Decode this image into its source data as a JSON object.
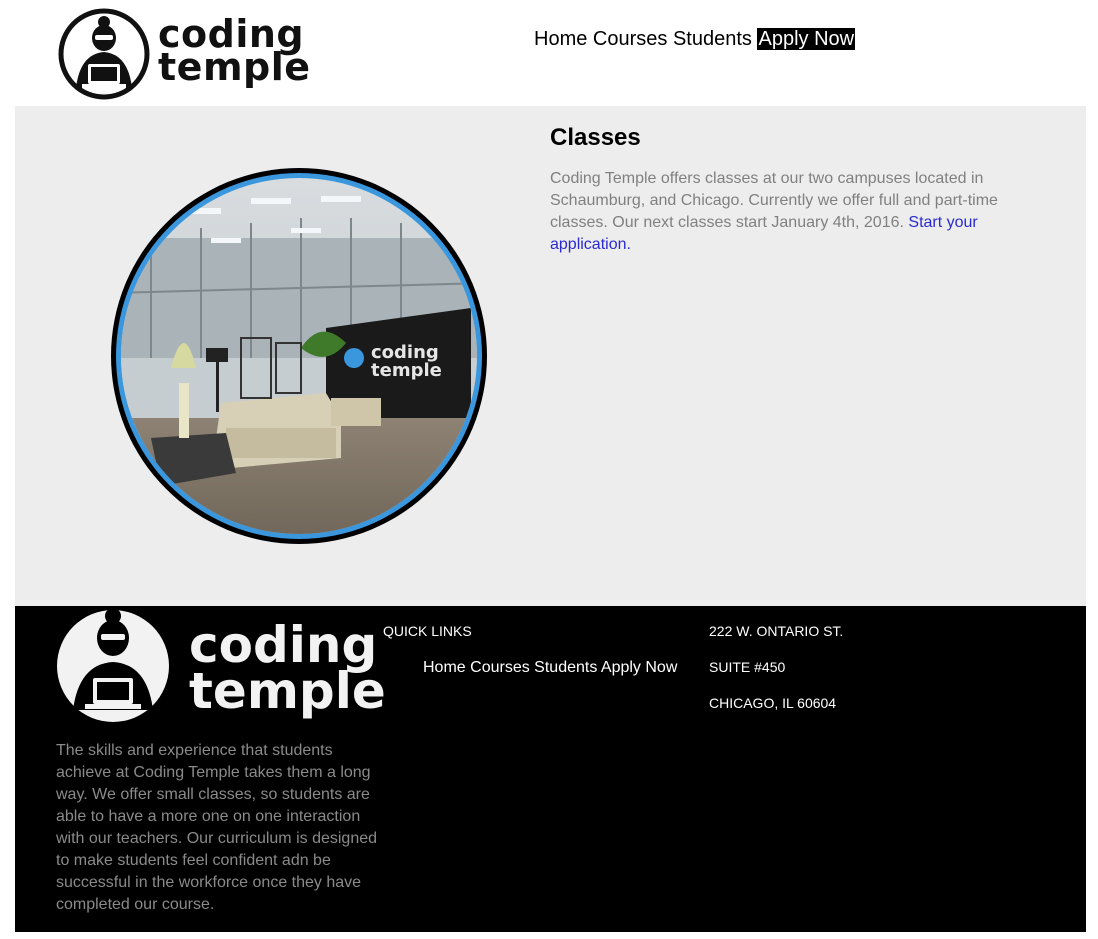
{
  "header": {
    "logo": {
      "line1": "coding",
      "line2": "temple"
    },
    "nav": {
      "home": "Home",
      "courses": "Courses",
      "students": "Students",
      "apply": "Apply Now"
    }
  },
  "main": {
    "title": "Classes",
    "text": "Coding Temple offers classes at our two campuses located in Schaumburg, and Chicago. Currently we offer full and part-time classes. Our next classes start January 4th, 2016. ",
    "link": "Start your application.",
    "photo_sign": {
      "line1": "coding",
      "line2": "temple"
    }
  },
  "footer": {
    "logo": {
      "line1": "coding",
      "line2": "temple"
    },
    "about": "The skills and experience that students achieve at Coding Temple takes them a long way. We offer small classes, so students are able to have a more one on one interaction with our teachers. Our curriculum is designed to make students feel confident adn be successful in the workforce once they have completed our course.",
    "quick_links_title": "QUICK LINKS",
    "nav": {
      "home": "Home",
      "courses": "Courses",
      "students": "Students",
      "apply": "Apply Now"
    },
    "address": {
      "line1": "222 W. ONTARIO ST.",
      "line2": "SUITE #450",
      "line3": "CHICAGO, IL 60604"
    }
  },
  "colors": {
    "section_bg": "#ededed",
    "footer_bg": "#000000",
    "link": "#2a2ad0",
    "photo_ring": "#3a97dd"
  }
}
